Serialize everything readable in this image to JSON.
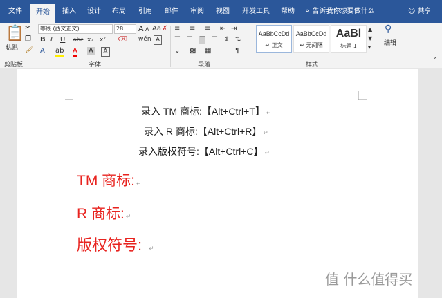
{
  "menu": {
    "tabs": [
      "文件",
      "开始",
      "插入",
      "设计",
      "布局",
      "引用",
      "邮件",
      "审阅",
      "视图",
      "开发工具",
      "帮助"
    ],
    "active_tab": "开始",
    "tell_me": "告诉我你想要做什么",
    "share": "共享"
  },
  "ribbon": {
    "clipboard": {
      "paste": "粘贴",
      "group": "剪贴板"
    },
    "font": {
      "name": "等线 (西文正文)",
      "size": "28",
      "group": "字体",
      "size_labels": [
        "A",
        "A"
      ],
      "aa": "Aa",
      "wen": "wén",
      "format_buttons": [
        "B",
        "I",
        "U",
        "abc",
        "x₂",
        "x²"
      ],
      "color_buttons": [
        "A",
        "ab",
        "A",
        "A",
        "A"
      ]
    },
    "paragraph": {
      "group": "段落"
    },
    "styles": {
      "group": "样式",
      "items": [
        {
          "sample": "AaBbCcDd",
          "name": "↵ 正文"
        },
        {
          "sample": "AaBbCcDd",
          "name": "↵ 无间隔"
        },
        {
          "sample": "AaBl",
          "name": "标题 1"
        }
      ]
    },
    "editing": {
      "label": "编辑"
    }
  },
  "document": {
    "lines_center": [
      "录入 TM 商标:【Alt+Ctrl+T】",
      "录入 R 商标:【Alt+Ctrl+R】",
      "录入版权符号:【Alt+Ctrl+C】"
    ],
    "lines_red": [
      "TM 商标:",
      "R 商标:",
      "版权符号:"
    ],
    "para_mark": "↵"
  },
  "watermark": "值 什么值得买",
  "colors": {
    "accent": "#2b579a",
    "red_text": "#e8231f"
  }
}
